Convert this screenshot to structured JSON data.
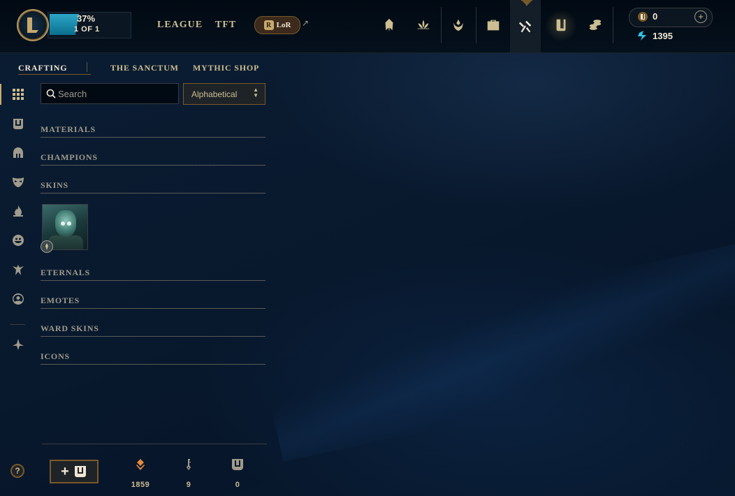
{
  "top_nav": {
    "progress_percent": "37%",
    "progress_count": "1 OF 1",
    "progress_fraction": 0.37,
    "links": [
      "LEAGUE",
      "TFT"
    ],
    "lor_label": "LoR",
    "lor_badge": "R",
    "icons": [
      "champion-helmet-icon",
      "lotus-icon",
      "ranked-emblem-icon",
      "collection-bag-icon",
      "crafting-hammer-icon",
      "loot-chest-icon",
      "store-coins-icon"
    ],
    "active_icon": "crafting-hammer-icon"
  },
  "currency": {
    "rp_value": "0",
    "be_value": "1395",
    "add_label": "+"
  },
  "sub_nav": {
    "tabs": [
      "CRAFTING",
      "THE SANCTUM",
      "MYTHIC SHOP"
    ],
    "active": "CRAFTING"
  },
  "sidebar": {
    "icons": [
      "grid-icon",
      "chest-icon",
      "champion-icon",
      "skin-mask-icon",
      "flame-icon",
      "emote-face-icon",
      "ward-icon",
      "profile-icon",
      "eternals-icon"
    ],
    "help_label": "?"
  },
  "filters": {
    "search_placeholder": "Search",
    "sort_value": "Alphabetical"
  },
  "categories": [
    {
      "label": "MATERIALS"
    },
    {
      "label": "CHAMPIONS"
    },
    {
      "label": "SKINS"
    },
    {
      "label": "ETERNALS"
    },
    {
      "label": "EMOTES"
    },
    {
      "label": "WARD SKINS"
    },
    {
      "label": "ICONS"
    }
  ],
  "skins": {
    "items": [
      {
        "icon": "skin-shard-card"
      }
    ]
  },
  "footer": {
    "add_button_plus": "+",
    "orange_essence": "1859",
    "keys": "9",
    "chests": "0"
  },
  "colors": {
    "gold": "#c8aa6e",
    "gold_dark": "#785a28",
    "text_light": "#f0e6d2",
    "text_muted": "#a09b8c",
    "background": "#071428",
    "orange_essence": "#e88a3c",
    "blue_essence": "#2ec4e6"
  }
}
